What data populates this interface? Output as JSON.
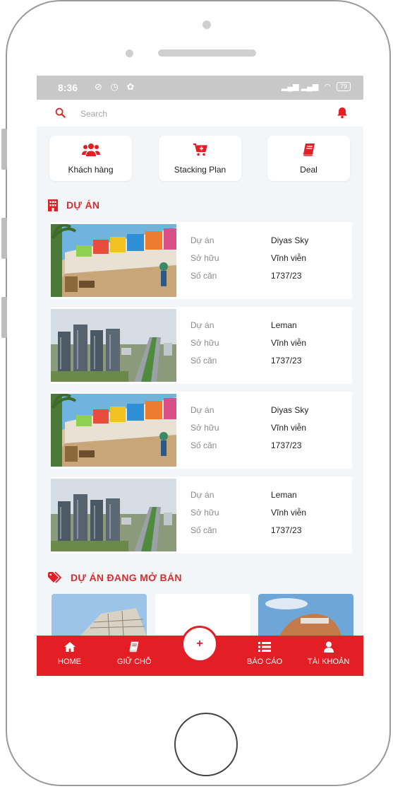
{
  "status_bar": {
    "time": "8:36",
    "battery": "79"
  },
  "search": {
    "placeholder": "Search"
  },
  "quick_actions": [
    {
      "label": "Khách hàng",
      "icon": "users-icon"
    },
    {
      "label": "Stacking Plan",
      "icon": "cart-plus-icon"
    },
    {
      "label": "Deal",
      "icon": "book-icon"
    }
  ],
  "projects_section": {
    "title": "DỰ ÁN",
    "icon": "building-icon"
  },
  "projects": [
    {
      "image": "shopfront-street-image",
      "fields": [
        {
          "key": "Dự án",
          "value": "Diyas Sky"
        },
        {
          "key": "Sở hữu",
          "value": "Vĩnh viễn"
        },
        {
          "key": "Số căn",
          "value": "1737/23"
        }
      ]
    },
    {
      "image": "towers-highway-image",
      "fields": [
        {
          "key": "Dự án",
          "value": "Leman"
        },
        {
          "key": "Sở hữu",
          "value": "Vĩnh viễn"
        },
        {
          "key": "Số căn",
          "value": "1737/23"
        }
      ]
    },
    {
      "image": "shopfront-street-image",
      "fields": [
        {
          "key": "Dự án",
          "value": "Diyas Sky"
        },
        {
          "key": "Sở hữu",
          "value": "Vĩnh viễn"
        },
        {
          "key": "Số căn",
          "value": "1737/23"
        }
      ]
    },
    {
      "image": "towers-highway-image",
      "fields": [
        {
          "key": "Dự án",
          "value": "Leman"
        },
        {
          "key": "Sở hữu",
          "value": "Vĩnh viễn"
        },
        {
          "key": "Số căn",
          "value": "1737/23"
        }
      ]
    }
  ],
  "on_sale_section": {
    "title": "DỰ ÁN ĐANG MỞ BÁN",
    "icon": "tags-icon"
  },
  "bottom_nav": {
    "items": [
      {
        "label": "HOME",
        "icon": "home-icon"
      },
      {
        "label": "GIỮ CHỖ",
        "icon": "book-icon"
      },
      {
        "label": "BÁO CÁO",
        "icon": "list-icon"
      },
      {
        "label": "TÀI KHOẢN",
        "icon": "user-icon"
      }
    ],
    "fab_symbol": "+"
  },
  "colors": {
    "accent": "#e31e24",
    "section_title": "#d32f2f",
    "background": "#f3f6f8"
  }
}
